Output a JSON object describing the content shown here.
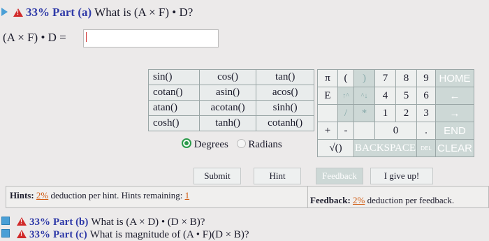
{
  "part_a": {
    "percent": "33%",
    "label": "Part (a)",
    "question": "What is (A × F) • D?"
  },
  "answer": {
    "prefix": "(A × F) • D =",
    "value": ""
  },
  "functions": [
    [
      "sin()",
      "cos()",
      "tan()"
    ],
    [
      "cotan()",
      "asin()",
      "acos()"
    ],
    [
      "atan()",
      "acotan()",
      "sinh()"
    ],
    [
      "cosh()",
      "tanh()",
      "cotanh()"
    ]
  ],
  "mode": {
    "degrees": "Degrees",
    "radians": "Radians"
  },
  "keypad": {
    "row1": [
      "π",
      "(",
      ")",
      "7",
      "8",
      "9",
      "HOME"
    ],
    "row2": [
      "E",
      "↑^",
      "^↓",
      "4",
      "5",
      "6",
      "←"
    ],
    "row3": [
      "",
      "/",
      "*",
      "1",
      "2",
      "3",
      "→"
    ],
    "row4": [
      "+",
      "-",
      "",
      "0",
      ".",
      "END"
    ],
    "row5": [
      "√()",
      "BACKSPACE",
      "DEL",
      "CLEAR"
    ]
  },
  "buttons": {
    "submit": "Submit",
    "hint": "Hint",
    "feedback": "Feedback",
    "give_up": "I give up!"
  },
  "hints": {
    "prefix": "Hints:",
    "percent": "2%",
    "text": "deduction per hint. Hints remaining:",
    "remaining": "1"
  },
  "feedback": {
    "prefix": "Feedback:",
    "percent": "2%",
    "text": "deduction per feedback."
  },
  "part_b": {
    "percent": "33%",
    "label": "Part (b)",
    "question": "What is (A × D) • (D × B)?"
  },
  "part_c": {
    "percent": "33%",
    "label": "Part (c)",
    "question": "What is magnitude of (A • F)(D × B)?"
  }
}
